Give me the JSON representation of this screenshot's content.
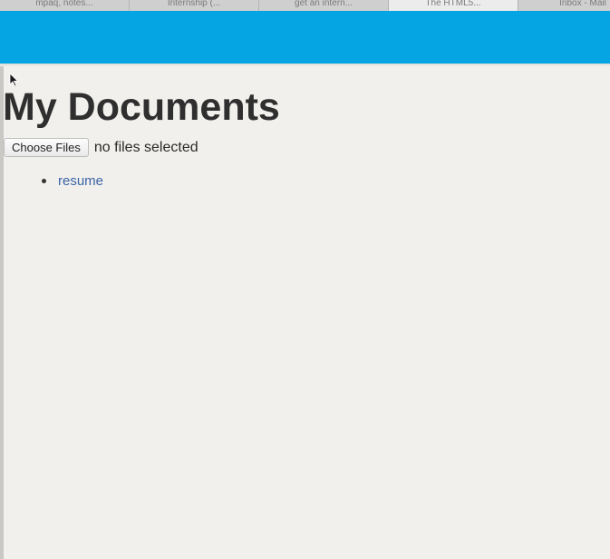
{
  "browser": {
    "tabs": [
      {
        "label": "mpaq, notes..."
      },
      {
        "label": "Internship (..."
      },
      {
        "label": "get an intern..."
      },
      {
        "label": "The HTML5..."
      },
      {
        "label": "Inbox - Mail"
      }
    ],
    "active_tab_index": 3
  },
  "header": {
    "band_color": "#05a5e3"
  },
  "page": {
    "title": "My Documents",
    "upload": {
      "button_label": "Choose Files",
      "status_text": "no files selected"
    },
    "documents": [
      {
        "name": "resume"
      }
    ]
  },
  "colors": {
    "background": "#f1f0ec",
    "link": "#3c63a8",
    "title": "#2f2f2f"
  },
  "icons": {
    "cursor": "mouse-pointer-icon",
    "bullet": "bullet-icon"
  }
}
